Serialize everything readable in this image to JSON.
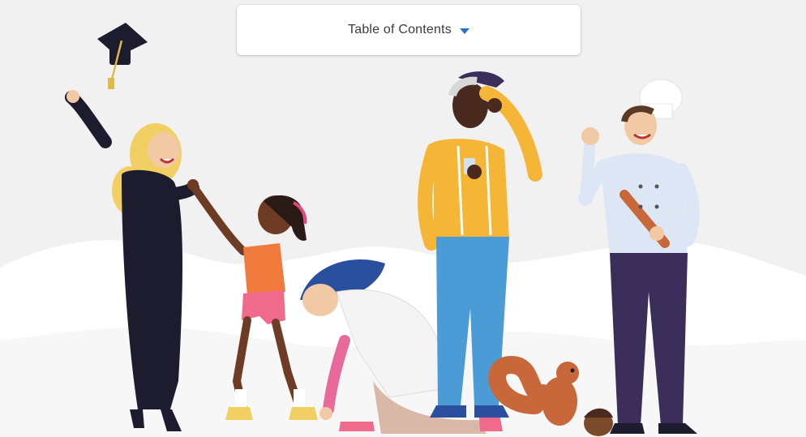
{
  "toc": {
    "label": "Table of Contents",
    "caret_icon": "caret-down-icon",
    "accent_color": "#2e6fd1"
  },
  "illustration": {
    "figures": [
      "graduate",
      "girl",
      "kneeling-woman",
      "older-man",
      "chef",
      "squirrel"
    ]
  }
}
